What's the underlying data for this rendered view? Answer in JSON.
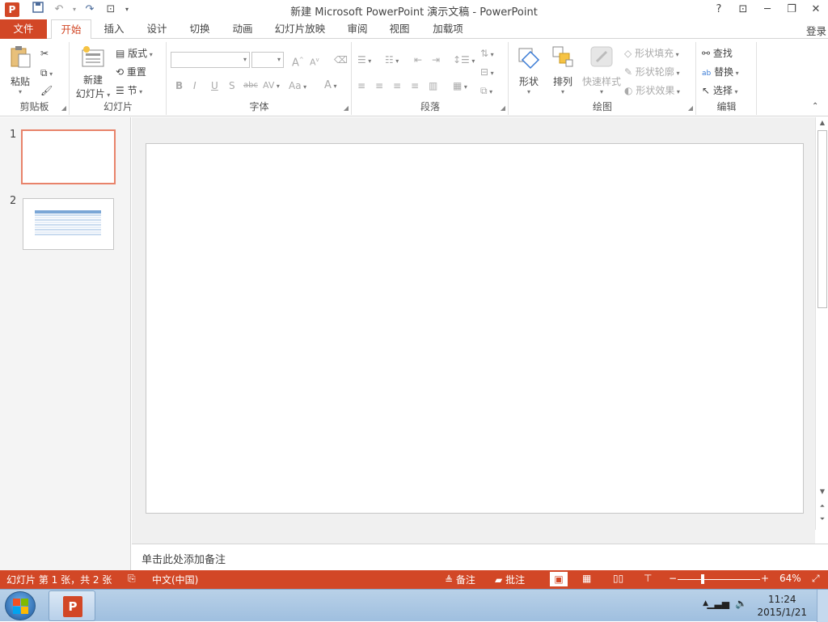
{
  "window": {
    "title": "新建 Microsoft PowerPoint 演示文稿 - PowerPoint",
    "help": "?",
    "login": "登录"
  },
  "tabs": [
    "文件",
    "开始",
    "插入",
    "设计",
    "切换",
    "动画",
    "幻灯片放映",
    "审阅",
    "视图",
    "加载项"
  ],
  "ribbon": {
    "clipboard": {
      "label": "剪贴板",
      "paste": "粘贴"
    },
    "slides": {
      "label": "幻灯片",
      "new_slide_line1": "新建",
      "new_slide_line2": "幻灯片",
      "layout": "版式",
      "reset": "重置",
      "section": "节"
    },
    "font": {
      "label": "字体",
      "bold": "B",
      "italic": "I",
      "underline": "U",
      "shadow": "S",
      "strike": "abc",
      "spacing": "AV",
      "case": "Aa",
      "color": "A",
      "grow": "A",
      "shrink": "A"
    },
    "paragraph": {
      "label": "段落"
    },
    "drawing": {
      "label": "绘图",
      "shapes": "形状",
      "arrange": "排列",
      "quick_styles": "快速样式",
      "shape_fill": "形状填充",
      "shape_outline": "形状轮廓",
      "shape_effects": "形状效果"
    },
    "editing": {
      "label": "编辑",
      "find": "查找",
      "replace": "替换",
      "select": "选择"
    }
  },
  "thumbnails": [
    {
      "num": "1"
    },
    {
      "num": "2"
    }
  ],
  "notes_placeholder": "单击此处添加备注",
  "status": {
    "slide_info": "幻灯片 第 1 张，共 2 张",
    "language": "中文(中国)",
    "notes": "备注",
    "comments": "批注",
    "zoom": "64%"
  },
  "taskbar": {
    "time": "11:24",
    "date": "2015/1/21"
  },
  "colors": {
    "accent": "#d24726"
  }
}
